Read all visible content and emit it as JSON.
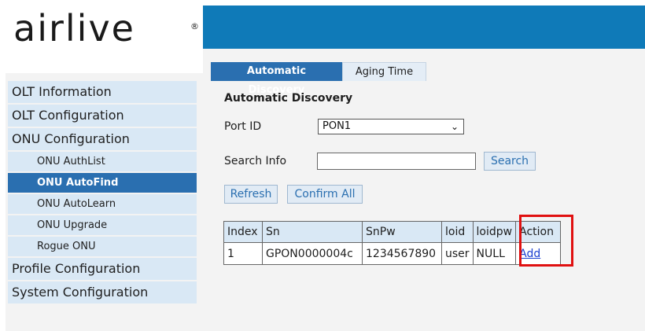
{
  "brand": {
    "logo_text": "airlive",
    "reg_mark": "®"
  },
  "sidebar": {
    "items": [
      {
        "label": "OLT Information",
        "level": 1
      },
      {
        "label": "OLT Configuration",
        "level": 1
      },
      {
        "label": "ONU Configuration",
        "level": 1
      },
      {
        "label": "ONU AuthList",
        "level": 2
      },
      {
        "label": "ONU AutoFind",
        "level": 2,
        "active": true
      },
      {
        "label": "ONU AutoLearn",
        "level": 2
      },
      {
        "label": "ONU Upgrade",
        "level": 2
      },
      {
        "label": "Rogue ONU",
        "level": 2
      },
      {
        "label": "Profile Configuration",
        "level": 1
      },
      {
        "label": "System Configuration",
        "level": 1
      }
    ]
  },
  "tabs": [
    {
      "label": "Automatic Discovery",
      "active": true
    },
    {
      "label": "Aging Time",
      "active": false
    }
  ],
  "main": {
    "section_title": "Automatic Discovery",
    "port_id_label": "Port ID",
    "port_id_value": "PON1",
    "search_info_label": "Search Info",
    "search_info_value": "",
    "search_button": "Search",
    "refresh_button": "Refresh",
    "confirm_all_button": "Confirm All"
  },
  "table": {
    "headers": [
      "Index",
      "Sn",
      "SnPw",
      "loid",
      "loidpw",
      "Action"
    ],
    "rows": [
      {
        "index": "1",
        "sn": "GPON0000004c",
        "snpw": "1234567890",
        "loid": "user",
        "loidpw": "NULL",
        "action": "Add"
      }
    ]
  },
  "colors": {
    "header_blue": "#0f7ab8",
    "active_blue": "#2a6fb0",
    "highlight_red": "#e01010"
  }
}
